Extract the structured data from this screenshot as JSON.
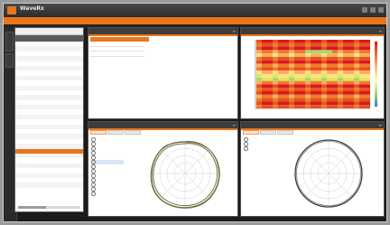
{
  "app": {
    "title": "WaveRx",
    "subtitle": "",
    "menu": [
      "",
      ""
    ]
  },
  "side_tabs": [
    "",
    ""
  ],
  "left_list": {
    "headers": [
      "",
      "",
      "",
      ""
    ],
    "selected_index": 22,
    "rows": [
      {
        "c1": "",
        "c2": "",
        "c3": "",
        "c4": ""
      },
      {
        "c1": "",
        "c2": "",
        "c3": "",
        "c4": ""
      },
      {
        "c1": "",
        "c2": "",
        "c3": "",
        "c4": ""
      },
      {
        "c1": "",
        "c2": "",
        "c3": "",
        "c4": ""
      },
      {
        "c1": "",
        "c2": "",
        "c3": "",
        "c4": ""
      },
      {
        "c1": "",
        "c2": "",
        "c3": "",
        "c4": ""
      },
      {
        "c1": "",
        "c2": "",
        "c3": "",
        "c4": ""
      },
      {
        "c1": "",
        "c2": "",
        "c3": "",
        "c4": ""
      },
      {
        "c1": "",
        "c2": "",
        "c3": "",
        "c4": ""
      },
      {
        "c1": "",
        "c2": "",
        "c3": "",
        "c4": ""
      },
      {
        "c1": "",
        "c2": "",
        "c3": "",
        "c4": ""
      },
      {
        "c1": "",
        "c2": "",
        "c3": "",
        "c4": ""
      },
      {
        "c1": "",
        "c2": "",
        "c3": "",
        "c4": ""
      },
      {
        "c1": "",
        "c2": "",
        "c3": "",
        "c4": ""
      },
      {
        "c1": "",
        "c2": "",
        "c3": "",
        "c4": ""
      },
      {
        "c1": "",
        "c2": "",
        "c3": "",
        "c4": ""
      },
      {
        "c1": "",
        "c2": "",
        "c3": "",
        "c4": ""
      },
      {
        "c1": "",
        "c2": "",
        "c3": "",
        "c4": ""
      },
      {
        "c1": "",
        "c2": "",
        "c3": "",
        "c4": ""
      },
      {
        "c1": "",
        "c2": "",
        "c3": "",
        "c4": ""
      },
      {
        "c1": "",
        "c2": "",
        "c3": "",
        "c4": ""
      },
      {
        "c1": "",
        "c2": "",
        "c3": "",
        "c4": ""
      },
      {
        "c1": "",
        "c2": "",
        "c3": "",
        "c4": ""
      },
      {
        "c1": "",
        "c2": "",
        "c3": "",
        "c4": ""
      },
      {
        "c1": "",
        "c2": "",
        "c3": "",
        "c4": ""
      },
      {
        "c1": "",
        "c2": "",
        "c3": "",
        "c4": ""
      },
      {
        "c1": "",
        "c2": "",
        "c3": "",
        "c4": ""
      },
      {
        "c1": "",
        "c2": "",
        "c3": "",
        "c4": ""
      },
      {
        "c1": "",
        "c2": "",
        "c3": "",
        "c4": ""
      },
      {
        "c1": "",
        "c2": "",
        "c3": "",
        "c4": ""
      }
    ]
  },
  "panels": {
    "top_left": {
      "title": ""
    },
    "top_right": {
      "title": ""
    },
    "bottom_left": {
      "title": "",
      "axis_caption": ""
    },
    "bottom_right": {
      "title": "",
      "axis_caption": ""
    }
  },
  "colors": {
    "accent": "#e8761c",
    "chrome": "#1b1b1b"
  }
}
